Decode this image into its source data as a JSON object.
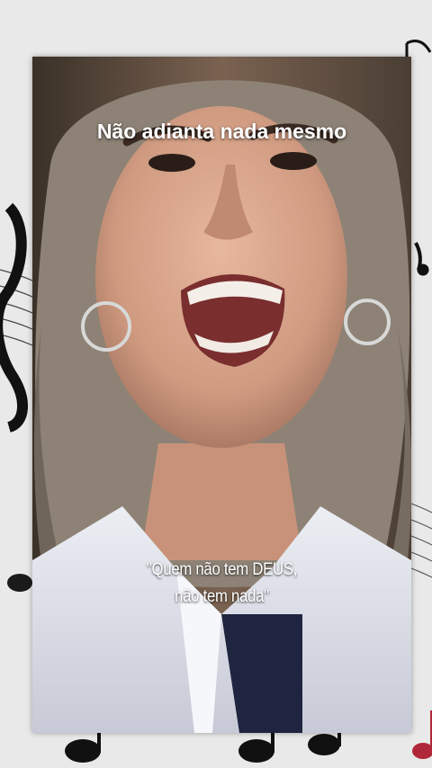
{
  "background": {
    "color": "#e9e9e9",
    "decoration_icons": [
      "music-note-icon",
      "treble-clef-icon",
      "music-staff-icon"
    ]
  },
  "video": {
    "caption_top": "Não adianta nada mesmo",
    "caption_bottom_line1": "\"Quem não tem DEUS,",
    "caption_bottom_line2": "não tem nada\""
  }
}
